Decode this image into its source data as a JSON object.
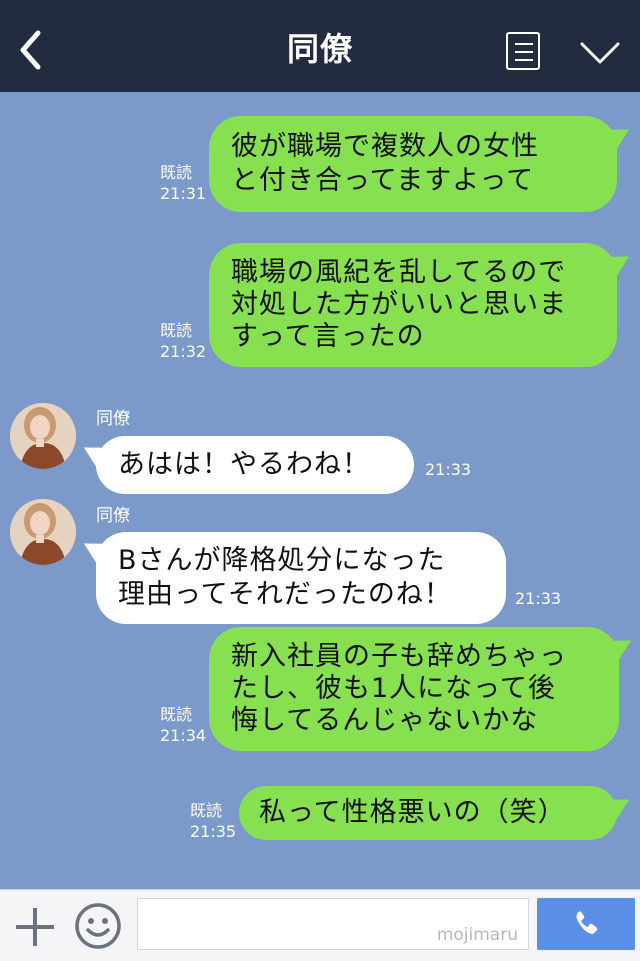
{
  "header": {
    "title": "同僚"
  },
  "messages": [
    {
      "side": "me",
      "lines": [
        "彼が職場で複数人の女性",
        "と付き合ってますよって"
      ],
      "read": "既読",
      "time": "21:31"
    },
    {
      "side": "me",
      "lines": [
        "職場の風紀を乱してるので",
        "対処した方がいいと思いま",
        "すって言ったの"
      ],
      "read": "既読",
      "time": "21:32"
    },
    {
      "side": "them",
      "sender": "同僚",
      "lines": [
        "あはは！やるわね！"
      ],
      "time": "21:33"
    },
    {
      "side": "them",
      "sender": "同僚",
      "lines": [
        "Bさんが降格処分になった",
        "理由ってそれだったのね！"
      ],
      "time": "21:33"
    },
    {
      "side": "me",
      "lines": [
        "新入社員の子も辞めちゃっ",
        "たし、彼も1人になって後",
        "悔してるんじゃないかな"
      ],
      "read": "既読",
      "time": "21:34"
    },
    {
      "side": "me",
      "lines": [
        "私って性格悪いの（笑）"
      ],
      "read": "既読",
      "time": "21:35"
    }
  ],
  "footer": {
    "watermark": "mojimaru"
  },
  "colors": {
    "header": "#222b3f",
    "background": "#7b9ac9",
    "my_bubble": "#86e04f",
    "their_bubble": "#ffffff",
    "call": "#5b8ee5"
  },
  "icons": [
    "back-icon",
    "menu-icon",
    "chevron-down-icon",
    "plus-icon",
    "emoji-icon",
    "phone-icon"
  ]
}
